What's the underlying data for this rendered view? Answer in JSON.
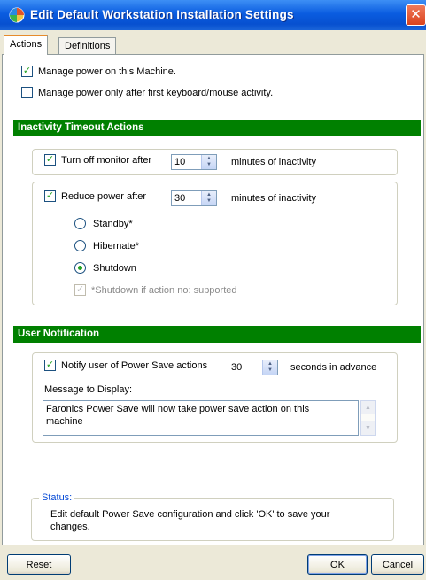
{
  "window": {
    "title": "Edit Default Workstation Installation Settings",
    "close_glyph": "✕"
  },
  "tabs": [
    "Actions",
    "Definitions"
  ],
  "actions": {
    "manage_power": {
      "label": "Manage power on this Machine.",
      "checked": true
    },
    "manage_after_activity": {
      "label": "Manage power only after first keyboard/mouse activity.",
      "checked": false
    }
  },
  "inactivity": {
    "header": "Inactivity Timeout Actions",
    "monitor": {
      "label": "Turn off monitor after",
      "value": "10",
      "suffix": "minutes of inactivity",
      "checked": true
    },
    "reduce": {
      "label": "Reduce power after",
      "value": "30",
      "suffix": "minutes of inactivity",
      "checked": true
    },
    "options": [
      {
        "label": "Standby*",
        "selected": false
      },
      {
        "label": "Hibernate*",
        "selected": false
      },
      {
        "label": "Shutdown",
        "selected": true
      }
    ],
    "shutdown_note": {
      "label": "*Shutdown if action no: supported",
      "checked": true
    }
  },
  "notification": {
    "header": "User Notification",
    "notify": {
      "label": "Notify user of Power Save actions",
      "value": "30",
      "suffix": "seconds in advance",
      "checked": true
    },
    "message_label": "Message to Display:",
    "message_line1": "Faronics Power Save will now take power save action on this",
    "message_line2": "machine"
  },
  "status": {
    "label": "Status:",
    "line1": "Edit default Power Save configuration and click 'OK' to save your",
    "line2": "changes."
  },
  "buttons": {
    "reset": "Reset",
    "ok": "OK",
    "cancel": "Cancel"
  },
  "glyphs": {
    "check": "✓",
    "up": "▲",
    "down": "▼"
  },
  "colors": {
    "section_header": "#008000",
    "check": "#21a121",
    "title_bar": "#0a5ce0",
    "status_label": "#0046d5"
  }
}
